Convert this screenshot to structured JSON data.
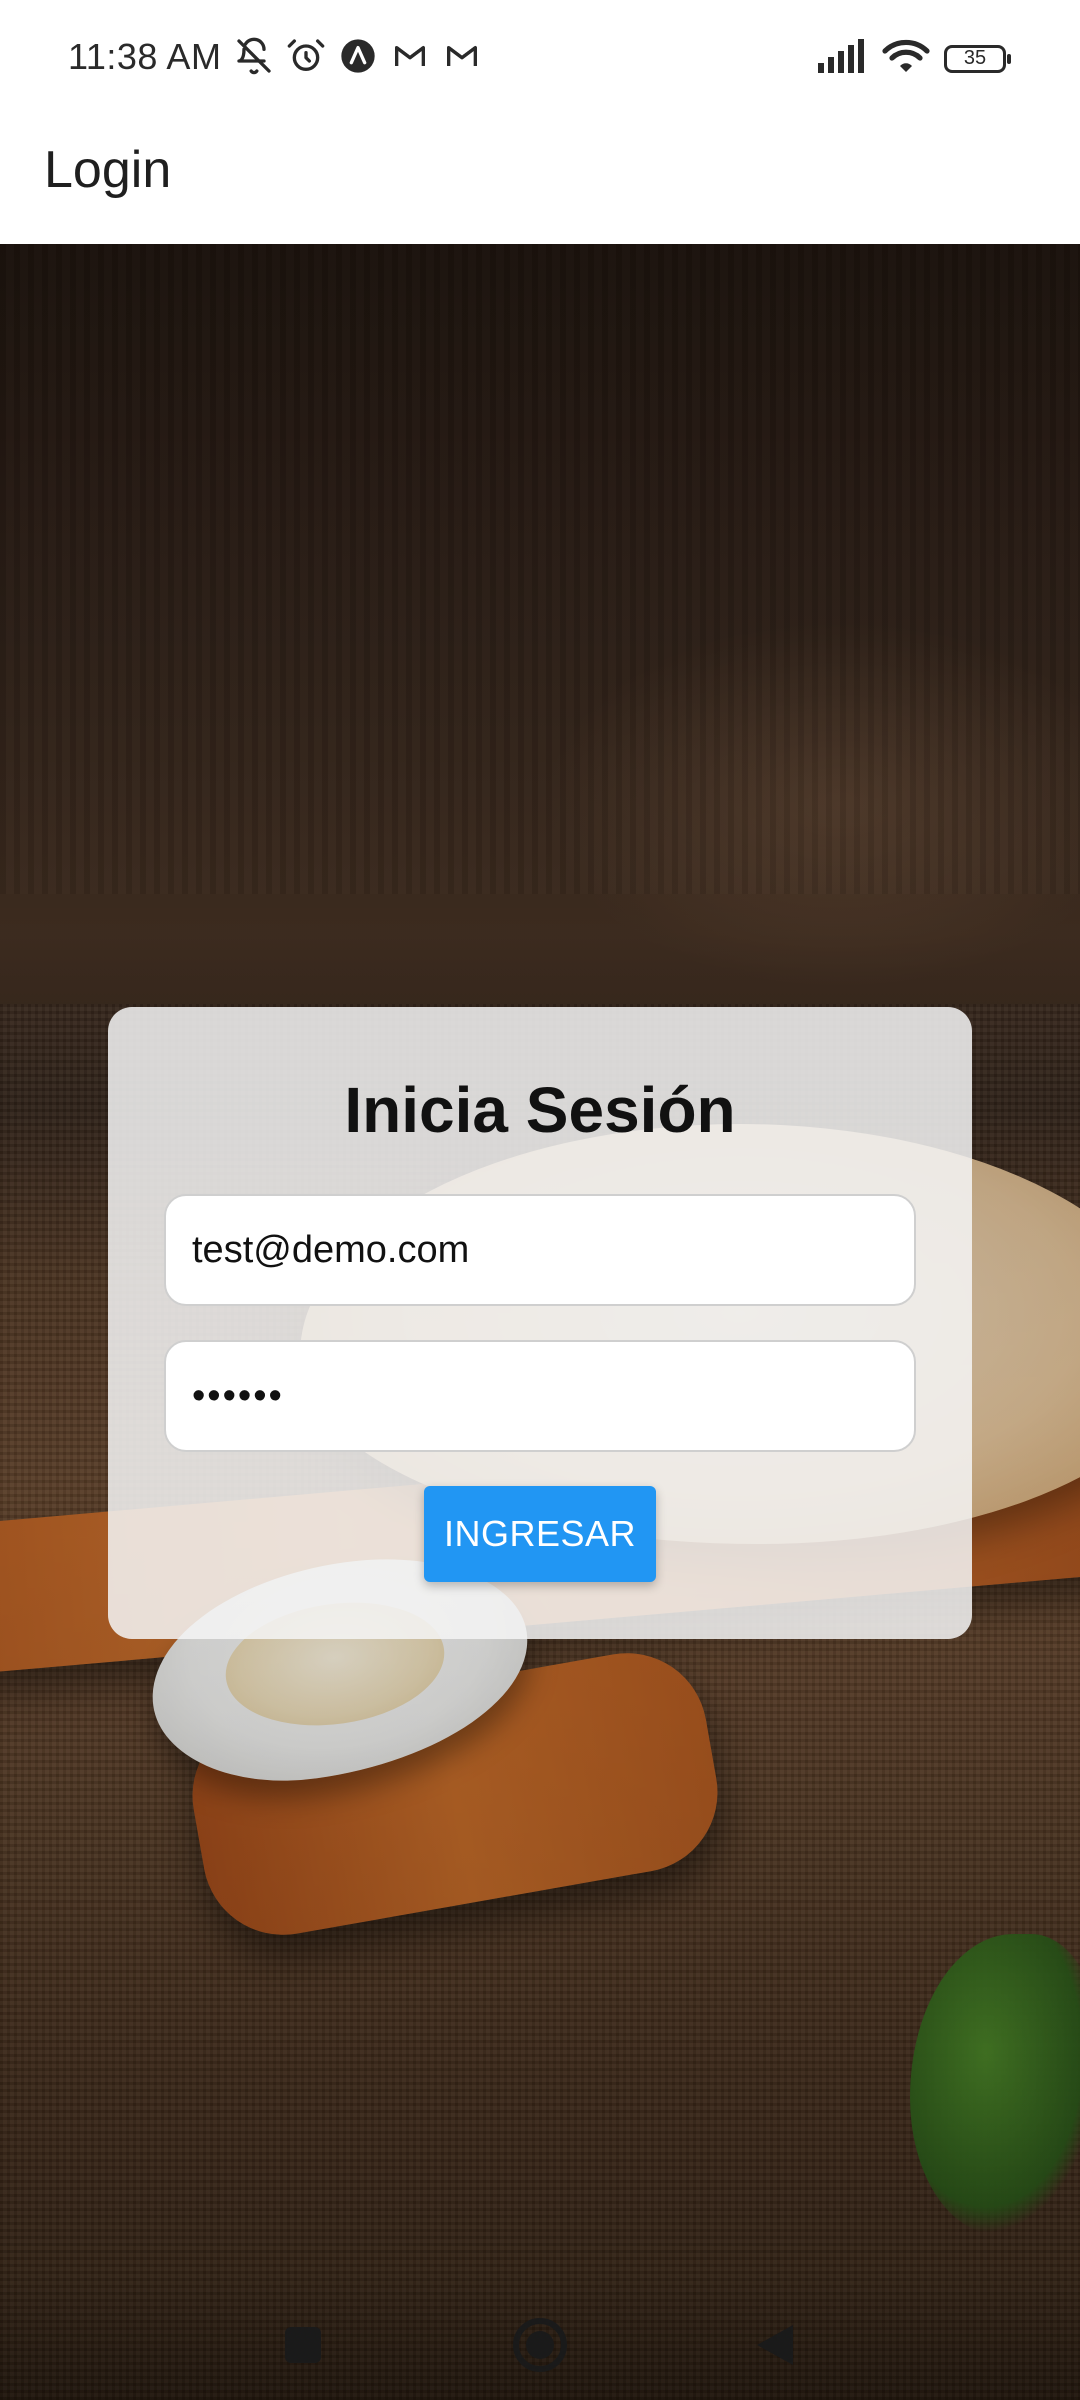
{
  "status_bar": {
    "time": "11:38 AM",
    "battery_level": "35",
    "icons_left": [
      "muted-bell-icon",
      "alarm-icon",
      "app-a-icon",
      "gmail-icon",
      "gmail-icon"
    ],
    "icons_right": [
      "signal-icon",
      "wifi-icon",
      "battery-icon"
    ]
  },
  "app_bar": {
    "title": "Login"
  },
  "login_card": {
    "title": "Inicia Sesión",
    "email_value": "test@demo.com",
    "password_value": "••••••",
    "submit_label": "INGRESAR"
  },
  "colors": {
    "primary_button": "#2196f3",
    "card_background": "#f5f5f5"
  },
  "nav_bar": {
    "buttons": [
      "recent-apps-icon",
      "home-icon",
      "back-icon"
    ]
  }
}
